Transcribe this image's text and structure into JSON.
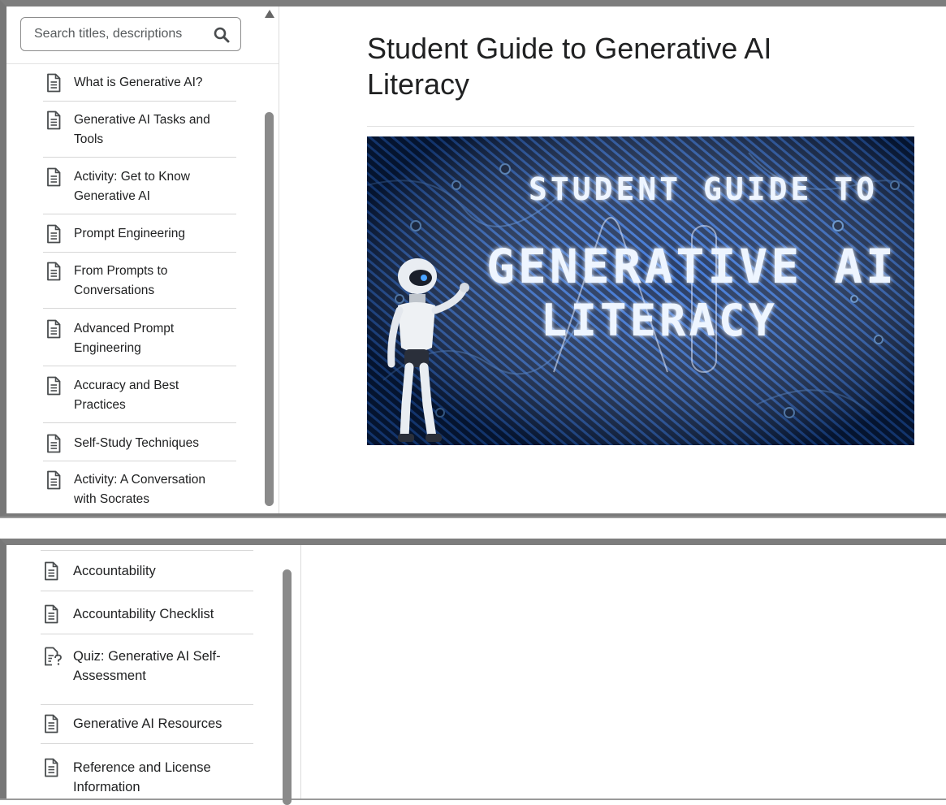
{
  "search": {
    "placeholder": "Search titles, descriptions"
  },
  "nav_top": [
    {
      "label": "What is Generative AI?",
      "icon": "document-icon"
    },
    {
      "label": "Generative AI Tasks and Tools",
      "icon": "document-icon"
    },
    {
      "label": "Activity: Get to Know Generative AI",
      "icon": "document-icon"
    },
    {
      "label": "Prompt Engineering",
      "icon": "document-icon"
    },
    {
      "label": "From Prompts to Conversations",
      "icon": "document-icon"
    },
    {
      "label": "Advanced Prompt Engineering",
      "icon": "document-icon"
    },
    {
      "label": "Accuracy and Best Practices",
      "icon": "document-icon"
    },
    {
      "label": "Self-Study Techniques",
      "icon": "document-icon"
    },
    {
      "label": "Activity: A Conversation with Socrates",
      "icon": "document-icon"
    }
  ],
  "nav_bottom": [
    {
      "label": "Accountability",
      "icon": "document-icon"
    },
    {
      "label": "Accountability Checklist",
      "icon": "document-icon"
    },
    {
      "label": "Quiz: Generative AI Self-Assessment",
      "icon": "quiz-icon"
    },
    {
      "label": "Generative AI Resources",
      "icon": "document-icon"
    },
    {
      "label": "Reference and License Information",
      "icon": "document-icon"
    }
  ],
  "main": {
    "title": "Student Guide to Generative AI Literacy",
    "banner": {
      "line1": "STUDENT GUIDE TO",
      "line2": "GENERATIVE AI",
      "line3": "LITERACY"
    }
  },
  "colors": {
    "banner_bg": "#071733",
    "circuit": "#1f5fc8",
    "glow_text": "#e8f2ff"
  }
}
